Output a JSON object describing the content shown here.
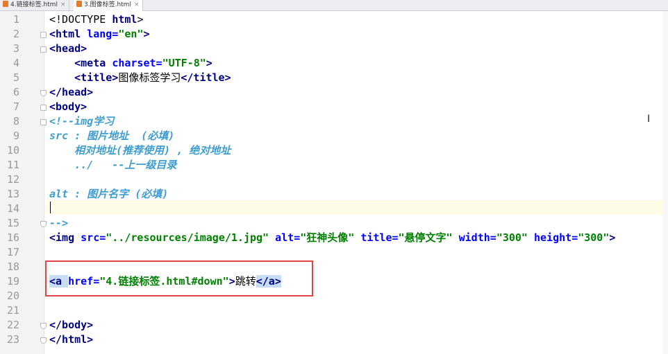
{
  "tabs": [
    {
      "label": "4.链接标签.html",
      "close": "×"
    },
    {
      "label": "3.图像标签.html",
      "close": "×"
    }
  ],
  "line_numbers": [
    "1",
    "2",
    "3",
    "4",
    "5",
    "6",
    "7",
    "8",
    "9",
    "10",
    "11",
    "12",
    "13",
    "14",
    "15",
    "16",
    "17",
    "18",
    "19",
    "20",
    "21",
    "22",
    "23"
  ],
  "code": {
    "l1_a": "<!DOCTYPE ",
    "l1_b": "html",
    "l1_c": ">",
    "l2_a": "<html ",
    "l2_attr": "lang",
    "l2_eq": "=",
    "l2_val": "\"en\"",
    "l2_c": ">",
    "l3": "<head>",
    "l4_indent": "    ",
    "l4_a": "<meta ",
    "l4_attr": "charset",
    "l4_eq": "=",
    "l4_val": "\"UTF-8\"",
    "l4_c": ">",
    "l5_indent": "    ",
    "l5_a": "<title>",
    "l5_text": "图像标签学习",
    "l5_c": "</title>",
    "l6": "</head>",
    "l7": "<body>",
    "l8": "<!--img学习",
    "l9": "src : 图片地址  (必填)",
    "l10": "    相对地址(推荐使用) , 绝对地址",
    "l11": "    ../   --上一级目录",
    "l13": "alt : 图片名字 (必填)",
    "l15": "-->",
    "l16_a": "<img ",
    "l16_attr1": "src",
    "l16_val1": "\"../resources/image/1.jpg\"",
    "l16_attr2": "alt",
    "l16_val2": "\"狂神头像\"",
    "l16_attr3": "title",
    "l16_val3": "\"悬停文字\"",
    "l16_attr4": "width",
    "l16_val4": "\"300\"",
    "l16_attr5": "height",
    "l16_val5": "\"300\"",
    "l16_c": ">",
    "l19_a": "<a ",
    "l19_attr": "href",
    "l19_eq": "=",
    "l19_val": "\"4.链接标签.html#down\"",
    "l19_c": ">",
    "l19_text": "跳转",
    "l19_end": "</a>",
    "l22": "</body>",
    "l23": "</html>"
  },
  "colors": {
    "tag": "#000080",
    "attr": "#0000ff",
    "value": "#008000",
    "comment": "#3f9dcf",
    "annotation": "#e04545"
  }
}
